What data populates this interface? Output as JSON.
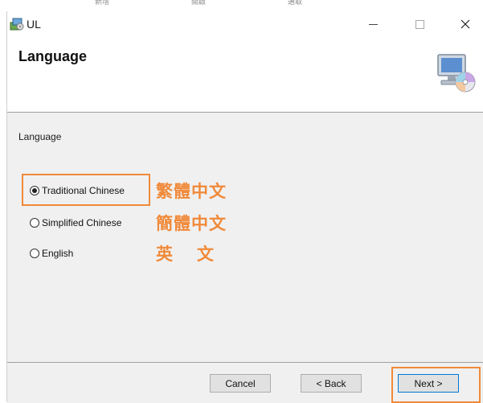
{
  "top_strip": {
    "cells": [
      "新增",
      "開啟",
      "選取"
    ]
  },
  "window": {
    "title": "UL"
  },
  "header": {
    "title": "Language"
  },
  "content": {
    "section_label": "Language",
    "options": [
      {
        "label": "Traditional Chinese",
        "selected": true,
        "annotation": "繁體中文"
      },
      {
        "label": "Simplified Chinese",
        "selected": false,
        "annotation": "簡體中文"
      },
      {
        "label": "English",
        "selected": false,
        "annotation": "英文"
      }
    ]
  },
  "footer": {
    "cancel_label": "Cancel",
    "back_label": "< Back",
    "next_label": "Next >"
  },
  "colors": {
    "annotation": "#f08a3a",
    "footer_bg": "#f0f0f0",
    "focus_border": "#0078d7"
  },
  "icons": [
    "setup-app-icon",
    "minimize-icon",
    "maximize-icon",
    "close-icon",
    "computer-cd-icon"
  ]
}
